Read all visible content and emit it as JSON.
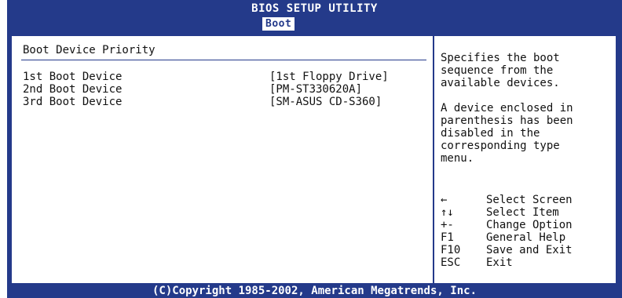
{
  "header": {
    "title": "BIOS SETUP UTILITY",
    "active_tab": "Boot"
  },
  "section": {
    "title": "Boot Device Priority"
  },
  "boot_devices": [
    {
      "label": "1st Boot Device",
      "value": "[1st Floppy Drive]"
    },
    {
      "label": "2nd Boot Device",
      "value": "[PM-ST330620A]"
    },
    {
      "label": "3rd Boot Device",
      "value": "[SM-ASUS CD-S360]"
    }
  ],
  "help": {
    "description": "Specifies the boot\nsequence from the\navailable devices.",
    "note": "A device enclosed in\nparenthesis has been\ndisabled in the\ncorresponding type\nmenu."
  },
  "keys": [
    {
      "key": "←",
      "icon": "arrow-left-icon",
      "action": "Select Screen"
    },
    {
      "key": "↑↓",
      "icon": "arrow-up-down-icon",
      "action": "Select Item"
    },
    {
      "key": "+-",
      "icon": "",
      "action": "Change Option"
    },
    {
      "key": "F1",
      "icon": "",
      "action": "General Help"
    },
    {
      "key": "F10",
      "icon": "",
      "action": "Save and Exit"
    },
    {
      "key": "ESC",
      "icon": "",
      "action": "Exit"
    }
  ],
  "footer": {
    "copyright": "(C)Copyright 1985-2002, American Megatrends, Inc."
  },
  "colors": {
    "bios_blue": "#243a8a",
    "panel_bg": "#ffffff",
    "text": "#111111"
  }
}
